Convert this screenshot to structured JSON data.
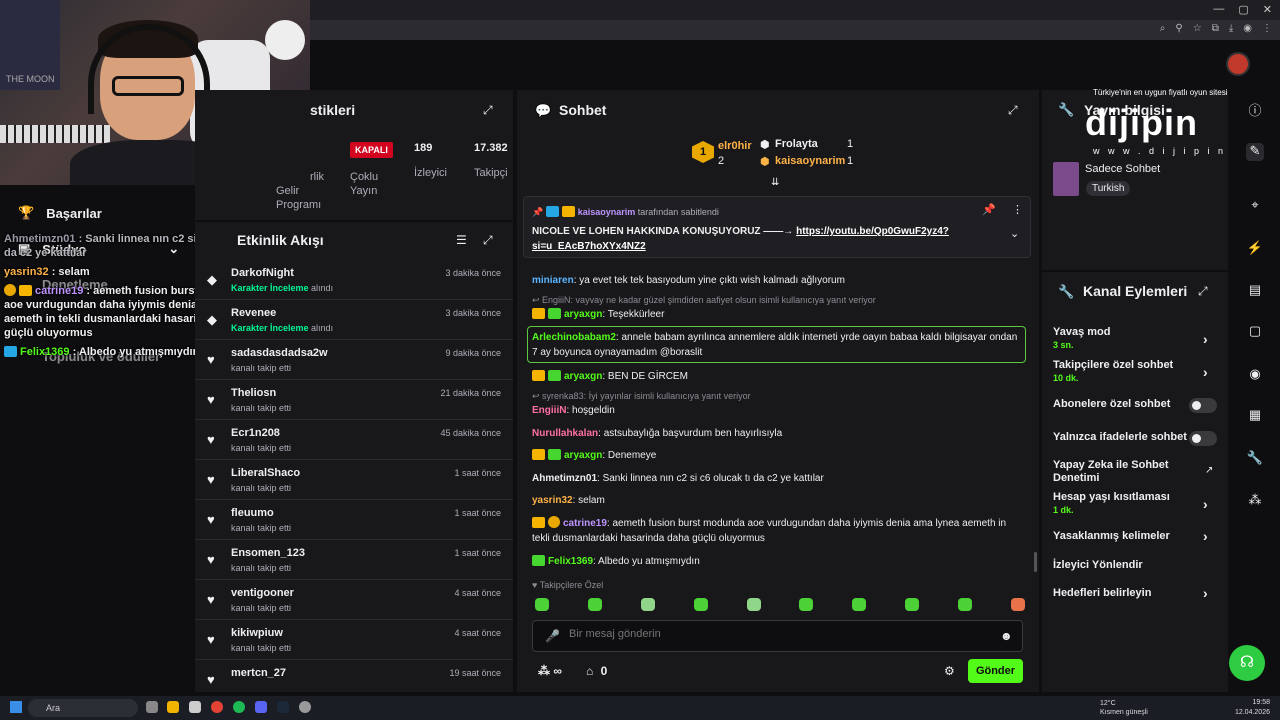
{
  "stream_overlay": {
    "webcam_poster_text": "THE MOON"
  },
  "left_sidebar": {
    "achievements": "Başarılar",
    "studio": "Stüdyo",
    "ghost_1": "Denetleme",
    "ghost_2": "Topluluk ve ödüller"
  },
  "overlay_chat": [
    {
      "user": "Ahmetimzn01",
      "text": " : Sanki linnea nın c2 si c6 olucak tı da c2 ye kattılar",
      "color": "#9a9aa8"
    },
    {
      "user": "yasrin32",
      "text": " : selam",
      "color": "#ffb347"
    },
    {
      "user": "catrine19",
      "text": " : aemeth fusion burst modunda aoe vurdugundan daha iyiymis denia ama lynea aemeth in tekli dusmanlardaki hasarinda daha güçlü oluyormus",
      "color": "#bf94ff"
    },
    {
      "user": "Felix1369",
      "text": " : Albedo yu atmışmıydın",
      "color": "#53fc18"
    }
  ],
  "stats": {
    "title": "stikleri",
    "col1_label": "rlik",
    "col1_sub": "Gelir Programı",
    "status_badge": "KAPALI",
    "multi_stream": "Çoklu Yayın",
    "viewers_value": "189",
    "viewers_label": "İzleyici",
    "followers_value": "17.382",
    "followers_label": "Takipçi"
  },
  "activity": {
    "title": "Etkinlik Akışı",
    "rows": [
      {
        "name": "DarkofNight",
        "sub_hl": "Karakter İnceleme",
        "sub": " alındı",
        "time": "3 dakika önce",
        "icon": "reward-icon"
      },
      {
        "name": "Revenee",
        "sub_hl": "Karakter İnceleme",
        "sub": " alındı",
        "time": "3 dakika önce",
        "icon": "reward-icon"
      },
      {
        "name": "sadasdasdadsa2w",
        "sub_hl": "",
        "sub": "kanalı takip etti",
        "time": "9 dakika önce",
        "icon": "heart-icon"
      },
      {
        "name": "Theliosn",
        "sub_hl": "",
        "sub": "kanalı takip etti",
        "time": "21 dakika önce",
        "icon": "heart-icon"
      },
      {
        "name": "Ecr1n208",
        "sub_hl": "",
        "sub": "kanalı takip etti",
        "time": "45 dakika önce",
        "icon": "heart-icon"
      },
      {
        "name": "LiberalShaco",
        "sub_hl": "",
        "sub": "kanalı takip etti",
        "time": "1 saat önce",
        "icon": "heart-icon"
      },
      {
        "name": "fleuumo",
        "sub_hl": "",
        "sub": "kanalı takip etti",
        "time": "1 saat önce",
        "icon": "heart-icon"
      },
      {
        "name": "Ensomen_123",
        "sub_hl": "",
        "sub": "kanalı takip etti",
        "time": "1 saat önce",
        "icon": "heart-icon"
      },
      {
        "name": "ventigooner",
        "sub_hl": "",
        "sub": "kanalı takip etti",
        "time": "4 saat önce",
        "icon": "heart-icon"
      },
      {
        "name": "kikiwpiuw",
        "sub_hl": "",
        "sub": "kanalı takip etti",
        "time": "4 saat önce",
        "icon": "heart-icon"
      },
      {
        "name": "mertcn_27",
        "sub_hl": "",
        "sub": "",
        "time": "19 saat önce",
        "icon": "heart-icon"
      }
    ]
  },
  "chat": {
    "title": "Sohbet",
    "leaderboard": {
      "first_user": "elr0hir",
      "first_count": "2",
      "second_user": "Frolayta",
      "second_count": "1",
      "third_user": "kaisaoynarim",
      "third_count": "1",
      "rank": "1"
    },
    "pinned": {
      "pinned_by": "kaisaoynarim",
      "pinned_suffix": "tarafından sabitlendi",
      "message": "NICOLE VE LOHEN HAKKINDA KONUŞUYORUZ ——→ ",
      "link": "https://youtu.be/Qp0GwuF2yz4?si=u_EAcB7hoXYx4NZ2"
    },
    "messages": [
      {
        "user": "miniaren",
        "text": ": ya evet tek tek basıyodum yine çıktı wish kalmadı ağlıyorum",
        "color": "#5ab4ff"
      },
      {
        "reply": "EngiiiN: vayvay ne kadar güzel şimdiden aafiyet olsun isimli kullanıcıya yanıt veriyor"
      },
      {
        "user": "aryaxgn",
        "text": ": Teşekkürleer",
        "color": "#53fc18"
      },
      {
        "user": "Arlechinobabam2",
        "text": ": annele babam ayrılınca annemlere aldık interneti yrde oayın babaa kaldı bilgisayar ondan 7 ay boyunca oynayamadım @boraslit",
        "color": "#53fc18"
      },
      {
        "user": "aryaxgn",
        "text": ": BEN DE GİRCEM",
        "color": "#53fc18"
      },
      {
        "reply": "syrenka83: İyi yayınlar isimli kullanıcıya yanıt veriyor"
      },
      {
        "user": "EngiiiN",
        "text": ": hoşgeldin",
        "color": "#ff6fa5"
      },
      {
        "user": "Nurullahkalan",
        "text": ": astsubaylığa başvurdum ben hayırlısıyla",
        "color": "#ff6fa5"
      },
      {
        "user": "aryaxgn",
        "text": ": Denemeye",
        "color": "#53fc18"
      },
      {
        "user": "Ahmetimzn01",
        "text": ": Sanki linnea nın c2 si c6 olucak tı da c2 ye kattılar",
        "color": "#efeff1"
      },
      {
        "user": "yasrin32",
        "text": ": selam",
        "color": "#ffb347"
      },
      {
        "user": "catrine19",
        "text": ": aemeth fusion burst modunda aoe vurdugundan daha iyiymis denia ama lynea aemeth in tekli dusmanlardaki hasarinda daha güçlü oluyormus",
        "color": "#bf94ff"
      },
      {
        "user": "Felix1369",
        "text": ": Albedo yu atmışmıydın",
        "color": "#53fc18"
      }
    ],
    "emote_section": "Takipçilere Özel",
    "input_placeholder": "Bir mesaj gönderin",
    "viewer_count_label": "∞",
    "points": "0",
    "send_label": "Gönder"
  },
  "stream_info": {
    "title": "Yayın bilgisi",
    "chat_mode": "Sadece Sohbet",
    "language": "Turkish"
  },
  "ad": {
    "tagline": "Türkiye'nin en uygun fiyatlı oyun sitesi",
    "brand": "dijipin",
    "url": "w w w . d i j i p i n . c o m"
  },
  "channel_actions": {
    "title": "Kanal Eylemleri",
    "slow_mode": "Yavaş mod",
    "slow_mode_value": "3 sn.",
    "followers_only": "Takipçilere özel sohbet",
    "followers_only_value": "10 dk.",
    "subs_only": "Abonelere özel sohbet",
    "emotes_only": "Yalnızca ifadelerle sohbet",
    "ai_moderation": "Yapay Zeka ile Sohbet Denetimi",
    "age_restriction": "Hesap yaşı kısıtlaması",
    "age_restriction_value": "1 dk.",
    "banned_words": "Yasaklanmış kelimeler",
    "redirect": "İzleyici Yönlendir",
    "goals": "Hedefleri belirleyin"
  },
  "taskbar": {
    "search": "Ara",
    "weather_temp": "12°C",
    "weather_desc": "Kısmen güneşli",
    "time": "19:58",
    "date": "12.04.2026"
  },
  "colors": {
    "accent": "#53fc18",
    "panel": "#18181b",
    "background": "#0e0e10"
  }
}
